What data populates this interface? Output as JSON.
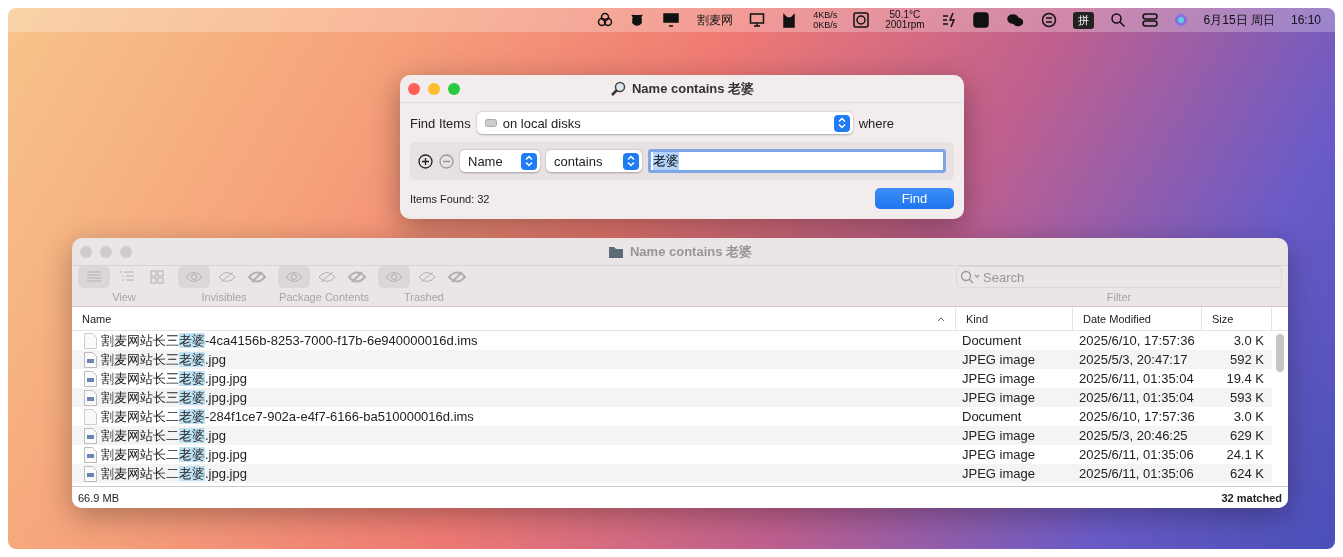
{
  "menubar": {
    "app_label": "割麦网",
    "net_up": "4KB/s",
    "net_down": "0KB/s",
    "temp": "50.1°C",
    "fan": "2001rpm",
    "input_method": "拼",
    "date": "6月15日 周日",
    "time": "16:10"
  },
  "find_dialog": {
    "title": "Name contains 老婆",
    "find_items_label": "Find Items",
    "location": "on local disks",
    "where_label": "where",
    "criteria": [
      {
        "attribute": "Name",
        "operator": "contains",
        "value": "老婆"
      }
    ],
    "items_found": "Items Found: 32",
    "find_button": "Find"
  },
  "results_window": {
    "title": "Name contains 老婆",
    "toolbar_groups": [
      {
        "label": "View",
        "buttons": [
          {
            "kind": "list",
            "selected": true
          },
          {
            "kind": "outline",
            "selected": false
          },
          {
            "kind": "grid",
            "selected": false
          }
        ]
      },
      {
        "label": "Invisibles",
        "buttons": [
          {
            "kind": "eye",
            "selected": true
          },
          {
            "kind": "eye-slash",
            "selected": false
          },
          {
            "kind": "eye-bold",
            "selected": false
          }
        ]
      },
      {
        "label": "Package Contents",
        "buttons": [
          {
            "kind": "eye",
            "selected": true
          },
          {
            "kind": "eye-slash",
            "selected": false
          },
          {
            "kind": "eye-bold",
            "selected": false
          }
        ]
      },
      {
        "label": "Trashed",
        "buttons": [
          {
            "kind": "eye",
            "selected": true
          },
          {
            "kind": "eye-slash",
            "selected": false
          },
          {
            "kind": "eye-bold",
            "selected": false
          }
        ]
      }
    ],
    "search": {
      "placeholder": "Search",
      "label": "Filter"
    },
    "columns": [
      {
        "label": "Name",
        "sorted": true
      },
      {
        "label": "Kind",
        "sorted": false
      },
      {
        "label": "Date Modified",
        "sorted": false
      },
      {
        "label": "Size",
        "sorted": false
      }
    ],
    "rows": [
      {
        "kind": "document",
        "name_before": "割麦网站长三",
        "name_match": "老婆",
        "name_after": "-4ca4156b-8253-7000-f17b-6e940000016d.ims",
        "file_kind": "Document",
        "date": "2025/6/10, 17:57:36",
        "size": "3.0 K"
      },
      {
        "kind": "image",
        "name_before": "割麦网站长三",
        "name_match": "老婆",
        "name_after": ".jpg",
        "file_kind": "JPEG image",
        "date": "2025/5/3, 20:47:17",
        "size": "592 K"
      },
      {
        "kind": "image",
        "name_before": "割麦网站长三",
        "name_match": "老婆",
        "name_after": ".jpg.jpg",
        "file_kind": "JPEG image",
        "date": "2025/6/11, 01:35:04",
        "size": "19.4 K"
      },
      {
        "kind": "image",
        "name_before": "割麦网站长三",
        "name_match": "老婆",
        "name_after": ".jpg.jpg",
        "file_kind": "JPEG image",
        "date": "2025/6/11, 01:35:04",
        "size": "593 K"
      },
      {
        "kind": "document",
        "name_before": "割麦网站长二",
        "name_match": "老婆",
        "name_after": "-284f1ce7-902a-e4f7-6166-ba510000016d.ims",
        "file_kind": "Document",
        "date": "2025/6/10, 17:57:36",
        "size": "3.0 K"
      },
      {
        "kind": "image",
        "name_before": "割麦网站长二",
        "name_match": "老婆",
        "name_after": ".jpg",
        "file_kind": "JPEG image",
        "date": "2025/5/3, 20:46:25",
        "size": "629 K"
      },
      {
        "kind": "image",
        "name_before": "割麦网站长二",
        "name_match": "老婆",
        "name_after": ".jpg.jpg",
        "file_kind": "JPEG image",
        "date": "2025/6/11, 01:35:06",
        "size": "24.1 K"
      },
      {
        "kind": "image",
        "name_before": "割麦网站长二",
        "name_match": "老婆",
        "name_after": ".jpg.jpg",
        "file_kind": "JPEG image",
        "date": "2025/6/11, 01:35:06",
        "size": "624 K"
      }
    ],
    "status_left": "66.9 MB",
    "status_right": "32 matched"
  }
}
